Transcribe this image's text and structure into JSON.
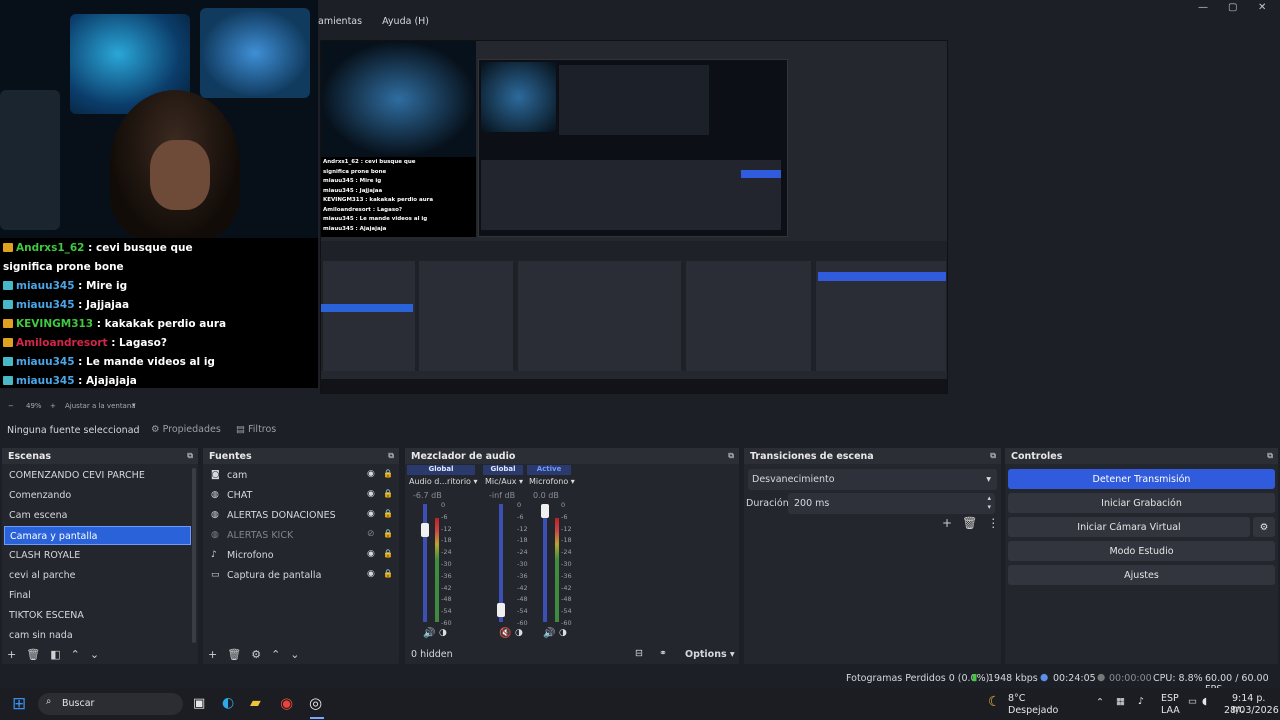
{
  "menu": [
    "amientas",
    "Ayuda (H)"
  ],
  "chat": [
    {
      "user": "Andrxs1_62",
      "color": "#3ec93e",
      "badge": "#e0a020",
      "msg": ": cevi busque que"
    },
    {
      "user": "",
      "color": "#ffffff",
      "badge": "",
      "msg": "significa prone bone"
    },
    {
      "user": "miauu345",
      "color": "#4aa6e8",
      "badge": "#48b8c8",
      "msg": ": Mire ig"
    },
    {
      "user": "miauu345",
      "color": "#4aa6e8",
      "badge": "#48b8c8",
      "msg": ": Jajjajaa"
    },
    {
      "user": "KEVINGM313",
      "color": "#3ec93e",
      "badge": "#e0a020",
      "msg": ": kakakak perdio aura"
    },
    {
      "user": "Amiloandresort",
      "color": "#d4264a",
      "badge": "#e0a020",
      "msg": ": Lagaso?"
    },
    {
      "user": "miauu345",
      "color": "#4aa6e8",
      "badge": "#48b8c8",
      "msg": ": Le mande videos al ig"
    },
    {
      "user": "miauu345",
      "color": "#4aa6e8",
      "badge": "#48b8c8",
      "msg": ": Ajajajaja"
    }
  ],
  "preview_bar": {
    "zoom": "49%",
    "fit": "Ajustar a la ventana"
  },
  "toolbar": {
    "no_source": "Ninguna fuente seleccionad",
    "properties": "Propiedades",
    "filters": "Filtros"
  },
  "docks": {
    "scenes": "Escenas",
    "sources": "Fuentes",
    "mixer": "Mezclador de audio",
    "transitions": "Transiciones de escena",
    "controls": "Controles"
  },
  "scenes": [
    "COMENZANDO CEVI PARCHE",
    "Comenzando",
    "Cam escena",
    "Camara y pantalla",
    "CLASH ROYALE",
    "cevi al parche",
    "Final",
    "TIKTOK ESCENA",
    "cam sin nada"
  ],
  "selected_scene": 3,
  "sources": [
    {
      "name": "cam",
      "icon": "camera-icon",
      "glyph": "◙",
      "visible": true
    },
    {
      "name": "CHAT",
      "icon": "browser-icon",
      "glyph": "◍",
      "visible": true
    },
    {
      "name": "ALERTAS DONACIONES",
      "icon": "browser-icon",
      "glyph": "◍",
      "visible": true
    },
    {
      "name": "ALERTAS KICK",
      "icon": "browser-icon",
      "glyph": "◍",
      "visible": false
    },
    {
      "name": "Microfono",
      "icon": "microphone-icon",
      "glyph": "♪",
      "visible": true
    },
    {
      "name": "Captura de pantalla",
      "icon": "monitor-icon",
      "glyph": "▭",
      "visible": true
    }
  ],
  "mixer": {
    "channels": [
      {
        "tag": "Global",
        "name": "Audio d...ritorio",
        "db": "-6.7 dB",
        "level": 0.82,
        "muted": false
      },
      {
        "tag": "Global",
        "name": "Mic/Aux",
        "db": "-inf dB",
        "level": 0.05,
        "muted": true
      },
      {
        "tag": "Active",
        "name": "Microfono",
        "db": "0.0 dB",
        "level": 1.0,
        "muted": false
      }
    ],
    "ticks": [
      "0",
      "-6",
      "-12",
      "-18",
      "-24",
      "-30",
      "-36",
      "-42",
      "-48",
      "-54",
      "-60"
    ],
    "hidden": "0 hidden",
    "options": "Options"
  },
  "transitions": {
    "type": "Desvanecimiento",
    "duration_label": "Duración",
    "duration": "200 ms"
  },
  "controls": {
    "stop_stream": "Detener Transmisión",
    "start_rec": "Iniciar Grabación",
    "virtual_cam": "Iniciar Cámara Virtual",
    "studio": "Modo Estudio",
    "settings": "Ajustes"
  },
  "status": {
    "dropped": "Fotogramas Perdidos 0 (0.0%)",
    "kbps": "1948 kbps",
    "live_time": "00:24:05",
    "rec_time": "00:00:00",
    "cpu": "CPU: 8.8%",
    "fps": "60.00 / 60.00 FPS"
  },
  "taskbar": {
    "search": "Buscar",
    "temp": "8°C",
    "weather": "Despejado",
    "lang1": "ESP",
    "lang2": "LAA",
    "time": "9:14 p. m.",
    "date": "28/03/2026"
  },
  "preview_chat": [
    "Andrxs1_62 : cevi busque que",
    "significa prone bone",
    "miauu345 : Mire ig",
    "miauu345 : Jajjajaa",
    "KEVINGM313 : kakakak perdio aura",
    "Amiloandresort : Lagaso?",
    "miauu345 : Le mande videos al ig",
    "miauu345 : Ajajajaja"
  ]
}
